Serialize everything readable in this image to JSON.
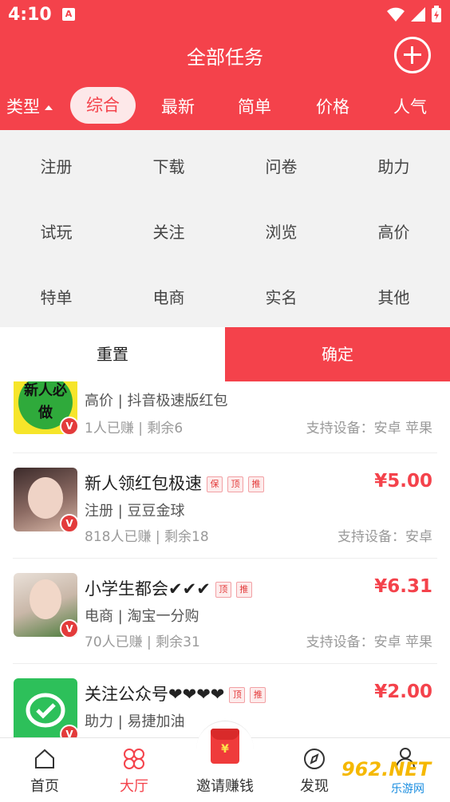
{
  "status_bar": {
    "time": "4:10",
    "notif_icon": "A"
  },
  "header": {
    "title": "全部任务",
    "add_icon": "plus-circle-icon"
  },
  "tabs": {
    "type_label": "类型",
    "items": [
      "综合",
      "最新",
      "简单",
      "价格",
      "人气"
    ],
    "active": "综合"
  },
  "filter": {
    "options": [
      "注册",
      "下载",
      "问卷",
      "助力",
      "试玩",
      "关注",
      "浏览",
      "高价",
      "特单",
      "电商",
      "实名",
      "其他"
    ],
    "reset": "重置",
    "confirm": "确定"
  },
  "tasks": [
    {
      "name": "",
      "price": "",
      "sub": "高价 | 抖音极速版红包",
      "earned": "1人已赚 |",
      "remain": "剩余6",
      "devices": "支持设备：安卓 苹果",
      "thumb_text": "新人必做",
      "tags": []
    },
    {
      "name": "新人领红包极速",
      "price": "¥5.00",
      "sub": "注册 | 豆豆金球",
      "earned": "818人已赚 |",
      "remain": "剩余18",
      "devices": "支持设备：安卓",
      "thumb_text": "",
      "tags": [
        "保",
        "顶",
        "推"
      ]
    },
    {
      "name": "小学生都会✔✔✔",
      "price": "¥6.31",
      "sub": "电商 | 淘宝一分购",
      "earned": "70人已赚 |",
      "remain": "剩余31",
      "devices": "支持设备：安卓 苹果",
      "thumb_text": "",
      "tags": [
        "顶",
        "推"
      ]
    },
    {
      "name": "关注公众号❤❤❤❤",
      "price": "¥2.00",
      "sub": "助力 | 易捷加油",
      "earned": "",
      "remain": "",
      "devices": "",
      "thumb_text": "",
      "tags": [
        "顶",
        "推"
      ]
    }
  ],
  "bottom_nav": [
    {
      "label": "首页",
      "icon": "home-icon"
    },
    {
      "label": "大厅",
      "icon": "hall-icon"
    },
    {
      "label": "邀请赚钱",
      "icon": "red-envelope-icon"
    },
    {
      "label": "发现",
      "icon": "compass-icon"
    },
    {
      "label": "",
      "icon": "user-icon"
    }
  ],
  "watermark": {
    "text": "962.NET",
    "sub": "乐游网"
  },
  "colors": {
    "primary": "#f4424b",
    "active_tab_bg": "#fde8e9",
    "filter_bg": "#f2f2f2"
  }
}
